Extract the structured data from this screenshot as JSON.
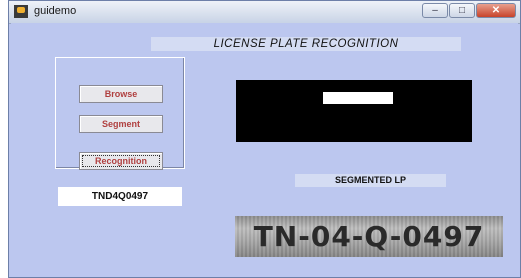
{
  "window": {
    "title": "guidemo",
    "controls": {
      "minimize": "–",
      "maximize": "□",
      "close": "✕"
    }
  },
  "heading": "LICENSE PLATE RECOGNITION",
  "buttons": {
    "browse": "Browse",
    "segment": "Segment",
    "recognition": "Recognition"
  },
  "result_text": "TND4Q0497",
  "segmented_label": "SEGMENTED LP",
  "plate_image_text": "TN-04-Q-0497"
}
